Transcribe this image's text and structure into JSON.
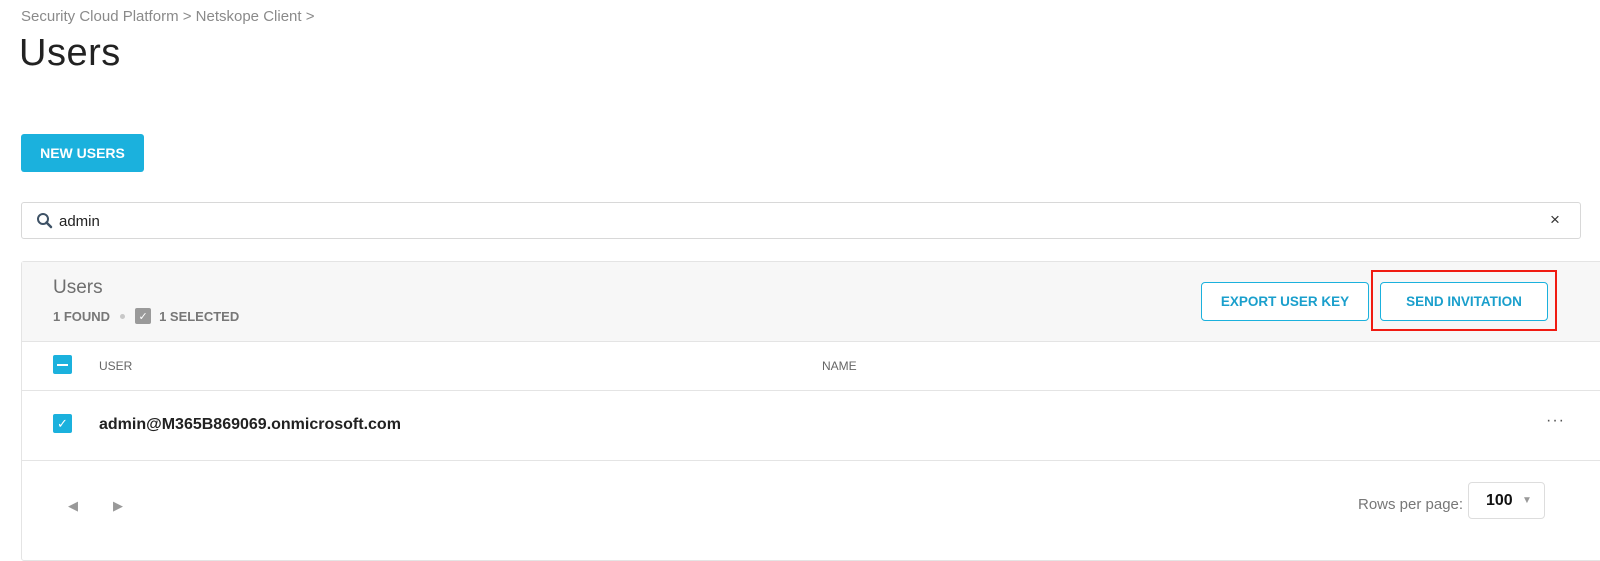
{
  "breadcrumb": "Security Cloud Platform > Netskope Client >",
  "page_title": "Users",
  "new_users_label": "NEW USERS",
  "search": {
    "value": "admin",
    "clear_label": "×"
  },
  "panel": {
    "title": "Users",
    "found": "1 FOUND",
    "selected": "1 SELECTED",
    "export_label": "EXPORT USER KEY",
    "invite_label": "SEND INVITATION",
    "columns": [
      "USER",
      "NAME"
    ],
    "rows": [
      {
        "user": "admin@M365B869069.onmicrosoft.com",
        "name": "",
        "selected": true
      }
    ],
    "more_label": "···",
    "rows_per_page_label": "Rows per page:",
    "rows_per_page": "100"
  },
  "colors": {
    "accent": "#1bb1dd",
    "highlight": "#f01b12"
  }
}
